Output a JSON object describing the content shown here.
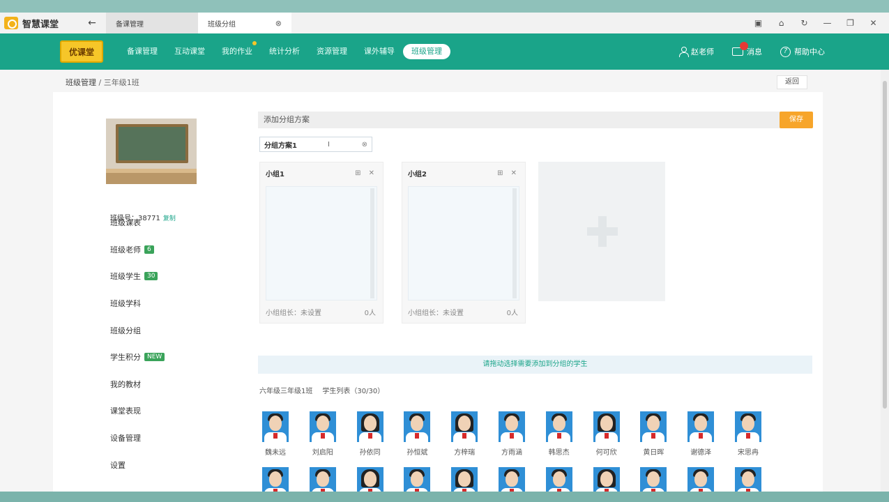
{
  "app": {
    "name": "智慧课堂",
    "back": "←"
  },
  "tabs": [
    {
      "label": "备课管理",
      "close": ""
    },
    {
      "label": "班级分组",
      "close": "⊗"
    }
  ],
  "window_controls": [
    "▣",
    "⌂",
    "↻",
    "—",
    "❐",
    "✕"
  ],
  "nav": {
    "brand": "优课堂",
    "items": [
      "备课管理",
      "互动课堂",
      "我的作业",
      "统计分析",
      "资源管理",
      "课外辅导",
      "班级管理"
    ],
    "active_index": 6,
    "user": "赵老师",
    "messages": "消息",
    "help": "帮助中心"
  },
  "breadcrumb": {
    "root": "班级管理",
    "sep": " / ",
    "current": "三年级1班"
  },
  "back_button": "返回",
  "sidebar": {
    "class_code_label": "班级号：38771",
    "class_code_tag": "复制",
    "items": [
      {
        "label": "班级课表",
        "badge": ""
      },
      {
        "label": "班级老师",
        "badge": "6"
      },
      {
        "label": "班级学生",
        "badge": "30"
      },
      {
        "label": "班级学科",
        "badge": ""
      },
      {
        "label": "班级分组",
        "badge": ""
      },
      {
        "label": "学生积分",
        "badge": "NEW"
      },
      {
        "label": "我的教材",
        "badge": ""
      },
      {
        "label": "课堂表现",
        "badge": ""
      },
      {
        "label": "设备管理",
        "badge": ""
      },
      {
        "label": "设置",
        "badge": ""
      }
    ]
  },
  "scheme": {
    "placeholder": "添加分组方案",
    "save": "保存",
    "tab_name": "分组方案1",
    "tab_caret": "I",
    "tab_close": "⊗"
  },
  "groups": [
    {
      "name": "小组1",
      "icons": "⊞ ✕",
      "footer_left": "小组组长：未设置",
      "footer_right": "0人"
    },
    {
      "name": "小组2",
      "icons": "⊞ ✕",
      "footer_left": "小组组长：未设置",
      "footer_right": "0人"
    }
  ],
  "hint": "请拖动选择需要添加到分组的学生",
  "roster": {
    "class": "六年级三年级1班",
    "title": "学生列表（30/30）"
  },
  "students": [
    "魏未远",
    "刘启阳",
    "孙依同",
    "孙恒斌",
    "方梓瑞",
    "方雨涵",
    "韩思杰",
    "何可欣",
    "黄日晖",
    "谢德泽",
    "宋思冉",
    "",
    "",
    "",
    "",
    "",
    "",
    "",
    "",
    "",
    "",
    ""
  ],
  "colors": {
    "nav_green": "#1aa489",
    "accent_orange": "#f7a52a",
    "brand_yellow": "#f6c629"
  }
}
